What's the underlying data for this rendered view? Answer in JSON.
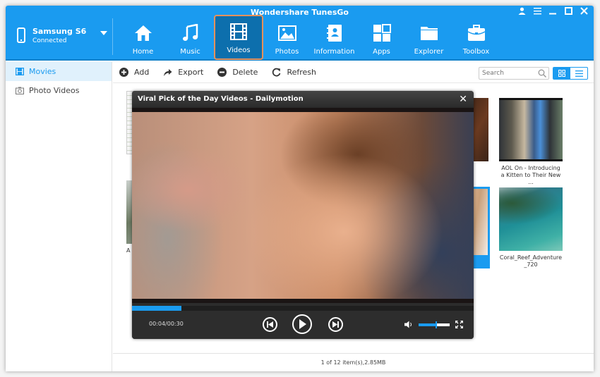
{
  "app": {
    "title": "Wondershare TunesGo",
    "window_controls": [
      "user-icon",
      "menu-icon",
      "minimize-icon",
      "maximize-icon",
      "close-icon"
    ]
  },
  "device": {
    "name": "Samsung S6",
    "status": "Connected"
  },
  "nav": [
    {
      "label": "Home",
      "icon": "home-icon"
    },
    {
      "label": "Music",
      "icon": "music-icon"
    },
    {
      "label": "Videos",
      "icon": "film-icon",
      "active": true
    },
    {
      "label": "Photos",
      "icon": "image-icon"
    },
    {
      "label": "Information",
      "icon": "contacts-icon"
    },
    {
      "label": "Apps",
      "icon": "apps-icon"
    },
    {
      "label": "Explorer",
      "icon": "folder-icon"
    },
    {
      "label": "Toolbox",
      "icon": "toolbox-icon"
    }
  ],
  "sidebar": {
    "items": [
      {
        "label": "Movies",
        "active": true
      },
      {
        "label": "Photo Videos"
      }
    ]
  },
  "toolbar": {
    "add_label": "Add",
    "export_label": "Export",
    "delete_label": "Delete",
    "refresh_label": "Refresh",
    "search_placeholder": "Search"
  },
  "videos": [
    {
      "caption": ""
    },
    {
      "caption": "AOL On - Introducing a Kitten to Their New ..."
    },
    {
      "caption": "A"
    },
    {
      "caption": "Coral_Reef_Adventure _720"
    }
  ],
  "player": {
    "title": "Viral Pick of the Day Videos - Dailymotion",
    "close": "✕",
    "time": "00:04/00:30",
    "progress_fraction": 0.145,
    "volume_fraction": 0.55
  },
  "status": {
    "text": "1 of 12 item(s),2.85MB"
  },
  "colors": {
    "accent": "#1a9bf0",
    "active_nav": "#0d6fad",
    "active_border": "#e6915b"
  }
}
